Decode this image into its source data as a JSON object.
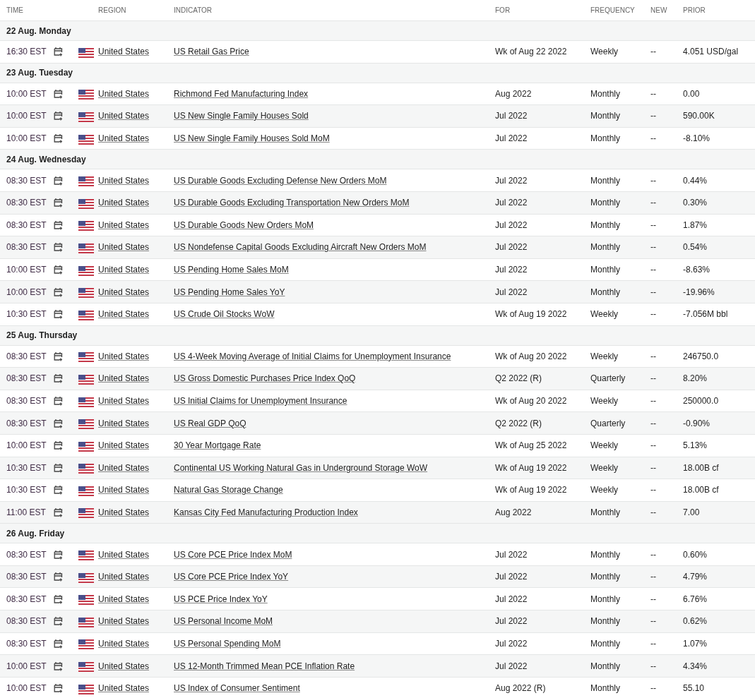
{
  "columns": [
    "TIME",
    "REGION",
    "INDICATOR",
    "FOR",
    "FREQUENCY",
    "NEW",
    "PRIOR"
  ],
  "days": [
    {
      "label": "22 Aug. Monday",
      "rows": [
        {
          "time": "16:30 EST",
          "region": "United States",
          "indicator": "US Retail Gas Price",
          "for": "Wk of Aug 22 2022",
          "frequency": "Weekly",
          "new": "--",
          "prior": "4.051 USD/gal"
        }
      ]
    },
    {
      "label": "23 Aug. Tuesday",
      "rows": [
        {
          "time": "10:00 EST",
          "region": "United States",
          "indicator": "Richmond Fed Manufacturing Index",
          "for": "Aug 2022",
          "frequency": "Monthly",
          "new": "--",
          "prior": "0.00"
        },
        {
          "time": "10:00 EST",
          "region": "United States",
          "indicator": "US New Single Family Houses Sold",
          "for": "Jul 2022",
          "frequency": "Monthly",
          "new": "--",
          "prior": "590.00K"
        },
        {
          "time": "10:00 EST",
          "region": "United States",
          "indicator": "US New Single Family Houses Sold MoM",
          "for": "Jul 2022",
          "frequency": "Monthly",
          "new": "--",
          "prior": "-8.10%"
        }
      ]
    },
    {
      "label": "24 Aug. Wednesday",
      "rows": [
        {
          "time": "08:30 EST",
          "region": "United States",
          "indicator": "US Durable Goods Excluding Defense New Orders MoM",
          "for": "Jul 2022",
          "frequency": "Monthly",
          "new": "--",
          "prior": "0.44%"
        },
        {
          "time": "08:30 EST",
          "region": "United States",
          "indicator": "US Durable Goods Excluding Transportation New Orders MoM",
          "for": "Jul 2022",
          "frequency": "Monthly",
          "new": "--",
          "prior": "0.30%"
        },
        {
          "time": "08:30 EST",
          "region": "United States",
          "indicator": "US Durable Goods New Orders MoM",
          "for": "Jul 2022",
          "frequency": "Monthly",
          "new": "--",
          "prior": "1.87%"
        },
        {
          "time": "08:30 EST",
          "region": "United States",
          "indicator": "US Nondefense Capital Goods Excluding Aircraft New Orders MoM",
          "for": "Jul 2022",
          "frequency": "Monthly",
          "new": "--",
          "prior": "0.54%"
        },
        {
          "time": "10:00 EST",
          "region": "United States",
          "indicator": "US Pending Home Sales MoM",
          "for": "Jul 2022",
          "frequency": "Monthly",
          "new": "--",
          "prior": "-8.63%"
        },
        {
          "time": "10:00 EST",
          "region": "United States",
          "indicator": "US Pending Home Sales YoY",
          "for": "Jul 2022",
          "frequency": "Monthly",
          "new": "--",
          "prior": "-19.96%"
        },
        {
          "time": "10:30 EST",
          "region": "United States",
          "indicator": "US Crude Oil Stocks WoW",
          "for": "Wk of Aug 19 2022",
          "frequency": "Weekly",
          "new": "--",
          "prior": "-7.056M bbl"
        }
      ]
    },
    {
      "label": "25 Aug. Thursday",
      "rows": [
        {
          "time": "08:30 EST",
          "region": "United States",
          "indicator": "US 4-Week Moving Average of Initial Claims for Unemployment Insurance",
          "for": "Wk of Aug 20 2022",
          "frequency": "Weekly",
          "new": "--",
          "prior": "246750.0"
        },
        {
          "time": "08:30 EST",
          "region": "United States",
          "indicator": "US Gross Domestic Purchases Price Index QoQ",
          "for": "Q2 2022 (R)",
          "frequency": "Quarterly",
          "new": "--",
          "prior": "8.20%"
        },
        {
          "time": "08:30 EST",
          "region": "United States",
          "indicator": "US Initial Claims for Unemployment Insurance",
          "for": "Wk of Aug 20 2022",
          "frequency": "Weekly",
          "new": "--",
          "prior": "250000.0"
        },
        {
          "time": "08:30 EST",
          "region": "United States",
          "indicator": "US Real GDP QoQ",
          "for": "Q2 2022 (R)",
          "frequency": "Quarterly",
          "new": "--",
          "prior": "-0.90%"
        },
        {
          "time": "10:00 EST",
          "region": "United States",
          "indicator": "30 Year Mortgage Rate",
          "for": "Wk of Aug 25 2022",
          "frequency": "Weekly",
          "new": "--",
          "prior": "5.13%"
        },
        {
          "time": "10:30 EST",
          "region": "United States",
          "indicator": "Continental US Working Natural Gas in Underground Storage WoW",
          "for": "Wk of Aug 19 2022",
          "frequency": "Weekly",
          "new": "--",
          "prior": "18.00B cf"
        },
        {
          "time": "10:30 EST",
          "region": "United States",
          "indicator": "Natural Gas Storage Change",
          "for": "Wk of Aug 19 2022",
          "frequency": "Weekly",
          "new": "--",
          "prior": "18.00B cf"
        },
        {
          "time": "11:00 EST",
          "region": "United States",
          "indicator": "Kansas City Fed Manufacturing Production Index",
          "for": "Aug 2022",
          "frequency": "Monthly",
          "new": "--",
          "prior": "7.00"
        }
      ]
    },
    {
      "label": "26 Aug. Friday",
      "rows": [
        {
          "time": "08:30 EST",
          "region": "United States",
          "indicator": "US Core PCE Price Index MoM",
          "for": "Jul 2022",
          "frequency": "Monthly",
          "new": "--",
          "prior": "0.60%"
        },
        {
          "time": "08:30 EST",
          "region": "United States",
          "indicator": "US Core PCE Price Index YoY",
          "for": "Jul 2022",
          "frequency": "Monthly",
          "new": "--",
          "prior": "4.79%"
        },
        {
          "time": "08:30 EST",
          "region": "United States",
          "indicator": "US PCE Price Index YoY",
          "for": "Jul 2022",
          "frequency": "Monthly",
          "new": "--",
          "prior": "6.76%"
        },
        {
          "time": "08:30 EST",
          "region": "United States",
          "indicator": "US Personal Income MoM",
          "for": "Jul 2022",
          "frequency": "Monthly",
          "new": "--",
          "prior": "0.62%"
        },
        {
          "time": "08:30 EST",
          "region": "United States",
          "indicator": "US Personal Spending MoM",
          "for": "Jul 2022",
          "frequency": "Monthly",
          "new": "--",
          "prior": "1.07%"
        },
        {
          "time": "10:00 EST",
          "region": "United States",
          "indicator": "US 12-Month Trimmed Mean PCE Inflation Rate",
          "for": "Jul 2022",
          "frequency": "Monthly",
          "new": "--",
          "prior": "4.34%"
        },
        {
          "time": "10:00 EST",
          "region": "United States",
          "indicator": "US Index of Consumer Sentiment",
          "for": "Aug 2022 (R)",
          "frequency": "Monthly",
          "new": "--",
          "prior": "55.10"
        }
      ]
    }
  ]
}
